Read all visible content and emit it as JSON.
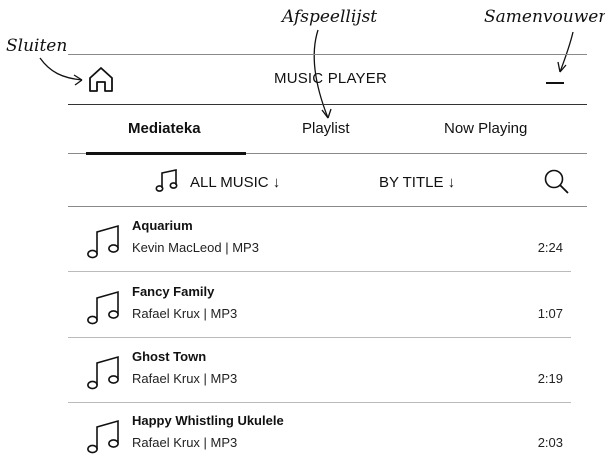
{
  "callouts": {
    "close": "Sluiten",
    "playlist": "Afspeellijst",
    "collapse": "Samenvouwen"
  },
  "header": {
    "title": "MUSIC PLAYER"
  },
  "tabs": [
    {
      "label": "Mediateka",
      "active": true
    },
    {
      "label": "Playlist",
      "active": false
    },
    {
      "label": "Now Playing",
      "active": false
    }
  ],
  "filters": {
    "source": "ALL MUSIC ↓",
    "sort": "BY TITLE ↓"
  },
  "songs": [
    {
      "title": "Aquarium",
      "meta": "Kevin MacLeod | MP3",
      "duration": "2:24"
    },
    {
      "title": "Fancy Family",
      "meta": "Rafael Krux | MP3",
      "duration": "1:07"
    },
    {
      "title": "Ghost Town",
      "meta": "Rafael Krux | MP3",
      "duration": "2:19"
    },
    {
      "title": "Happy Whistling Ukulele",
      "meta": "Rafael Krux | MP3",
      "duration": "2:03"
    }
  ],
  "icons": {
    "home": "home-icon",
    "collapse": "minimize-icon",
    "music": "music-note-icon",
    "search": "search-icon"
  }
}
